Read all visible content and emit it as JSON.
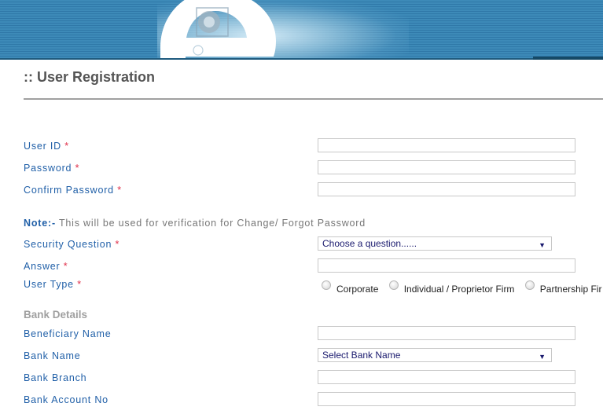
{
  "header": {
    "logo_icon": "e-logo-icon",
    "page_title": ":: User Registration"
  },
  "form": {
    "required_marker": "*",
    "fields": {
      "user_id": {
        "label": "User ID",
        "value": ""
      },
      "password": {
        "label": "Password",
        "value": ""
      },
      "confirm_password": {
        "label": "Confirm Password",
        "value": ""
      },
      "security_question": {
        "label": "Security Question",
        "selected": "Choose a question......"
      },
      "answer": {
        "label": "Answer",
        "value": ""
      },
      "user_type": {
        "label": "User Type",
        "options": [
          "Corporate",
          "Individual / Proprietor Firm",
          "Partnership Fir"
        ]
      }
    },
    "note": {
      "prefix": "Note:-",
      "text": " This will be used for verification for Change/ Forgot Password"
    },
    "bank_details": {
      "heading": "Bank Details",
      "beneficiary_name": {
        "label": "Beneficiary Name",
        "value": ""
      },
      "bank_name": {
        "label": "Bank Name",
        "selected": "Select Bank Name"
      },
      "bank_branch": {
        "label": "Bank Branch",
        "value": ""
      },
      "bank_account_no": {
        "label": "Bank Account No",
        "value": ""
      }
    },
    "dropdown_arrow": "▼"
  },
  "colors": {
    "label": "#2160a8",
    "required": "#e0304a",
    "banner": "#3d8ab8",
    "title": "#555555"
  }
}
